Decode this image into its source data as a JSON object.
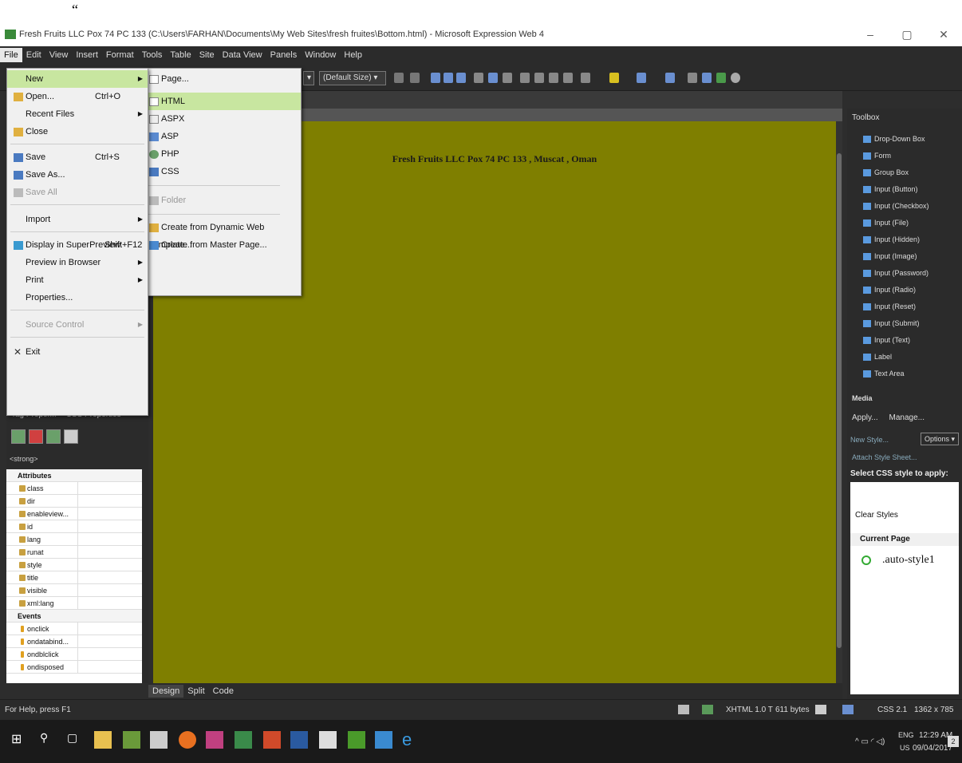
{
  "stray_mark": "“",
  "window": {
    "title": "Fresh Fruits LLC Pox 74 PC 133 (C:\\Users\\FARHAN\\Documents\\My Web Sites\\fresh fruites\\Bottom.html) - Microsoft Expression Web 4",
    "controls": [
      "–",
      "▢",
      "✕"
    ]
  },
  "menu": [
    "File",
    "Edit",
    "View",
    "Insert",
    "Format",
    "Tools",
    "Table",
    "Site",
    "Data View",
    "Panels",
    "Window",
    "Help"
  ],
  "toolbar": {
    "size_combo": "(Default Size)"
  },
  "file_menu": {
    "items": [
      {
        "label": "New",
        "shortcut": "",
        "arrow": true
      },
      {
        "label": "Open...",
        "shortcut": "Ctrl+O",
        "arrow": false
      },
      {
        "label": "Recent Files",
        "shortcut": "",
        "arrow": true
      },
      {
        "label": "Close",
        "shortcut": "",
        "arrow": false
      },
      {
        "label": "Save",
        "shortcut": "Ctrl+S",
        "arrow": false
      },
      {
        "label": "Save As...",
        "shortcut": "",
        "arrow": false
      },
      {
        "label": "Save All",
        "shortcut": "",
        "arrow": false
      },
      {
        "label": "Import",
        "shortcut": "",
        "arrow": true
      },
      {
        "label": "Display in SuperPreview",
        "shortcut": "Shift+F12",
        "arrow": false
      },
      {
        "label": "Preview in Browser",
        "shortcut": "",
        "arrow": true
      },
      {
        "label": "Print",
        "shortcut": "",
        "arrow": true
      },
      {
        "label": "Properties...",
        "shortcut": "",
        "arrow": false
      },
      {
        "label": "Source Control",
        "shortcut": "",
        "arrow": true
      },
      {
        "label": "Exit",
        "shortcut": "",
        "arrow": false
      }
    ]
  },
  "new_submenu": {
    "items": [
      "Page...",
      "HTML",
      "ASPX",
      "ASP",
      "PHP",
      "CSS",
      "Folder",
      "Create from Dynamic Web Template...",
      "Create from Master Page..."
    ]
  },
  "document": {
    "heading": "Fresh Fruits LLC  Pox 74 PC 133 , Muscat , Oman"
  },
  "view_tabs": [
    "Design",
    "Split",
    "Code"
  ],
  "left_panel": {
    "tabs": [
      "Tag Proper...",
      "CSS Properties"
    ],
    "tag": "<strong>",
    "attributes_label": "Attributes",
    "attributes": [
      "class",
      "dir",
      "enableview...",
      "id",
      "lang",
      "runat",
      "style",
      "title",
      "visible",
      "xml:lang"
    ],
    "events_label": "Events",
    "events": [
      "onclick",
      "ondatabind...",
      "ondblclick",
      "ondisposed"
    ]
  },
  "toolbox": {
    "title": "Toolbox",
    "items": [
      "Drop-Down Box",
      "Form",
      "Group Box",
      "Input (Button)",
      "Input (Checkbox)",
      "Input (File)",
      "Input (Hidden)",
      "Input (Image)",
      "Input (Password)",
      "Input (Radio)",
      "Input (Reset)",
      "Input (Submit)",
      "Input (Text)",
      "Label",
      "Text Area"
    ],
    "media": "Media"
  },
  "apply_panel": {
    "tabs": [
      "Apply...",
      "Manage..."
    ],
    "new_style": "New Style...",
    "options": "Options",
    "attach": "Attach Style Sheet...",
    "select_label": "Select CSS style to apply:",
    "clear": "Clear Styles",
    "current_page": "Current Page",
    "style": ".auto-style1"
  },
  "status": {
    "help": "For Help, press F1",
    "doctype": "XHTML 1.0 T",
    "size": "611 bytes",
    "css": "CSS 2.1",
    "dims": "1362 x 785"
  },
  "taskbar": {
    "lang": "ENG",
    "region": "US",
    "time": "12:29 AM",
    "date": "09/04/2017",
    "notif": "2"
  }
}
